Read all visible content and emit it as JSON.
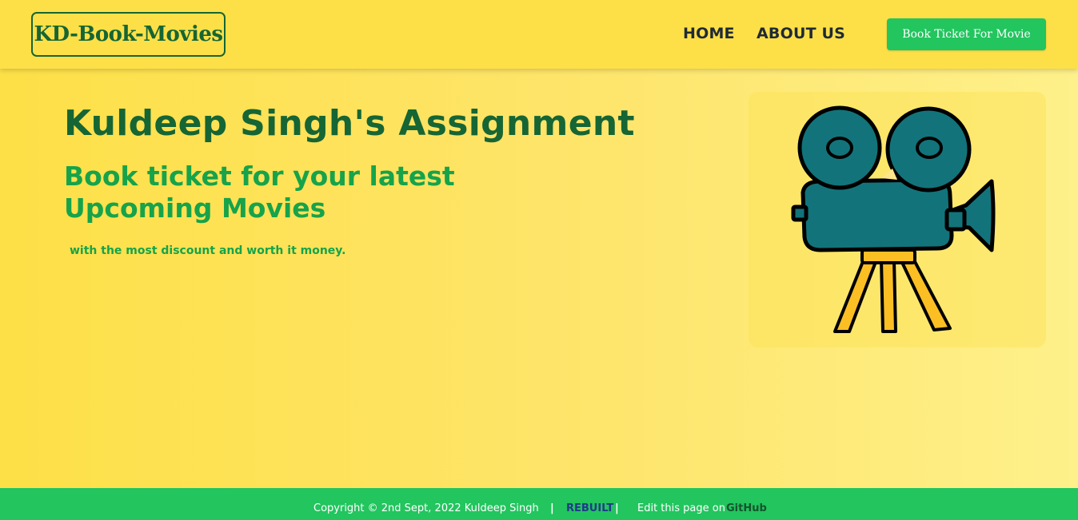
{
  "navbar": {
    "logo": "KD-Book-Movies",
    "links": [
      {
        "label": "HOME"
      },
      {
        "label": "ABOUT US"
      }
    ],
    "cta_label": "Book Ticket For Movie"
  },
  "hero": {
    "title": "Kuldeep Singh's Assignment",
    "subtitle": "Book ticket for your latest Upcoming Movies",
    "text": "with the most discount and worth it money.",
    "image_icon": "movie-camera-icon"
  },
  "footer": {
    "copyright": "Copyright © 2nd Sept, 2022 Kuldeep Singh",
    "separator": "|",
    "rebuilt": "REBUILT",
    "edit_text": "Edit this page on",
    "github": "GitHub"
  },
  "colors": {
    "background": "#fde047",
    "dark_green": "#166534",
    "green": "#16a34a",
    "button_green": "#22c55e",
    "camera_teal": "#12747a",
    "camera_legs": "#fbbf24"
  }
}
